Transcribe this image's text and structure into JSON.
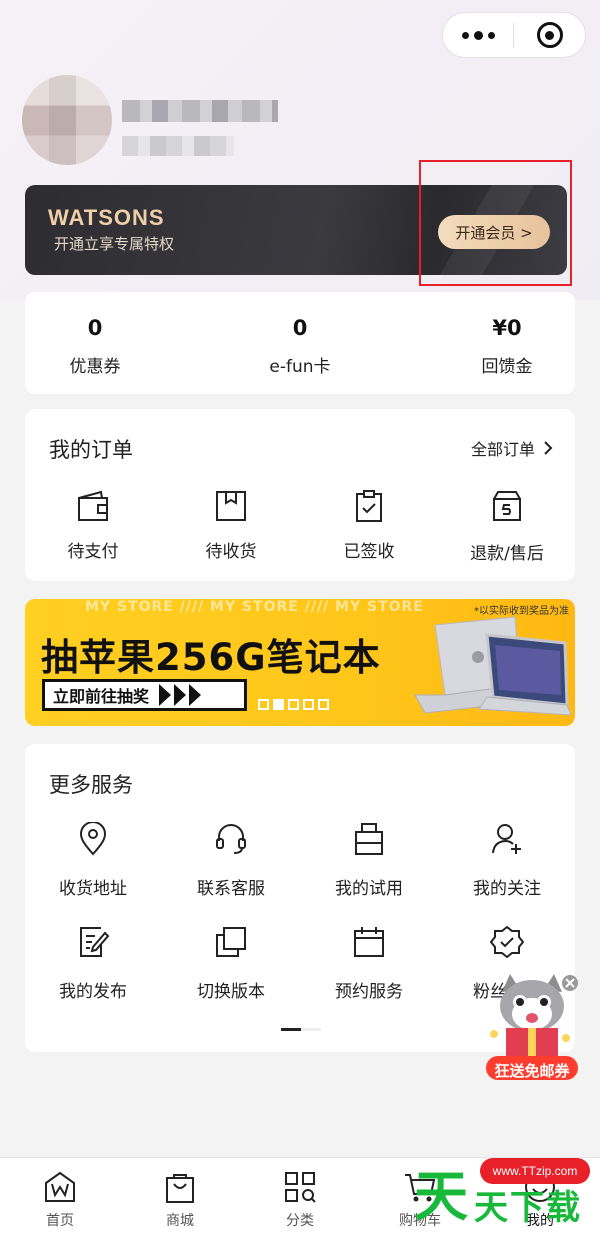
{
  "vip": {
    "brand": "WATSONS",
    "tagline": "开通立享专属特权",
    "cta": "开通会员 >"
  },
  "stats": [
    {
      "value": "0",
      "label": "优惠券"
    },
    {
      "value": "0",
      "label": "e-fun卡"
    },
    {
      "value": "¥0",
      "label": "回馈金"
    }
  ],
  "orders": {
    "title": "我的订单",
    "all_label": "全部订单",
    "items": [
      {
        "label": "待支付",
        "icon": "wallet-icon"
      },
      {
        "label": "待收货",
        "icon": "package-icon"
      },
      {
        "label": "已签收",
        "icon": "clipboard-check-icon"
      },
      {
        "label": "退款/售后",
        "icon": "return-box-icon"
      }
    ]
  },
  "promo": {
    "watermark": "MY STORE  ////  MY STORE  ////  MY STORE",
    "note": "*以实际收到奖品为准",
    "headline": "抽苹果256G笔记本",
    "button": "立即前往抽奖",
    "pages": 5,
    "active_page": 2
  },
  "services": {
    "title": "更多服务",
    "items": [
      {
        "label": "收货地址",
        "icon": "location-pin-icon"
      },
      {
        "label": "联系客服",
        "icon": "headset-icon"
      },
      {
        "label": "我的试用",
        "icon": "trial-box-icon"
      },
      {
        "label": "我的关注",
        "icon": "user-plus-icon"
      },
      {
        "label": "我的发布",
        "icon": "edit-document-icon"
      },
      {
        "label": "切换版本",
        "icon": "switch-version-icon"
      },
      {
        "label": "预约服务",
        "icon": "calendar-icon"
      },
      {
        "label": "粉丝福利",
        "icon": "badge-check-icon"
      }
    ]
  },
  "floater": {
    "text": "狂送免邮券"
  },
  "tabbar": [
    {
      "label": "首页",
      "icon": "home-w-icon"
    },
    {
      "label": "商城",
      "icon": "shopping-bag-icon"
    },
    {
      "label": "分类",
      "icon": "category-grid-icon"
    },
    {
      "label": "购物车",
      "icon": "cart-icon"
    },
    {
      "label": "我的",
      "icon": "smile-icon"
    }
  ],
  "watermark_logo": {
    "url_text": "www.TTzip.com",
    "text": "天天下载"
  }
}
